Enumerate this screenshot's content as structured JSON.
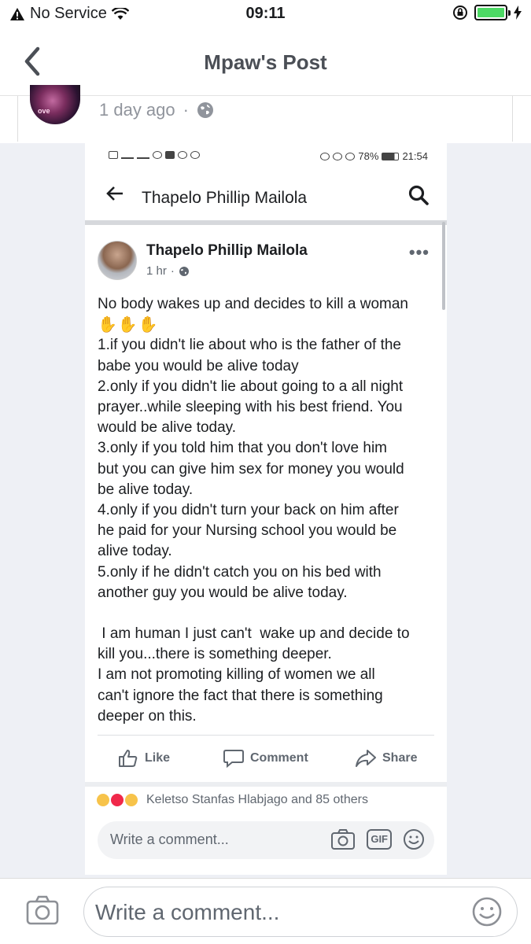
{
  "status_bar": {
    "carrier": "No Service",
    "time": "09:11",
    "icons": [
      "warning-icon",
      "wifi-icon",
      "orientation-lock-icon",
      "battery-icon",
      "charging-icon"
    ],
    "battery_color": "#4cd964"
  },
  "nav": {
    "title": "Mpaw's Post",
    "back_icon": "chevron-left-icon"
  },
  "outer_post": {
    "time": "1 day ago",
    "separator": "·",
    "privacy_icon": "globe-icon",
    "avatar_text": "ove"
  },
  "inner_screenshot": {
    "status_bar": {
      "battery": "78%",
      "time": "21:54"
    },
    "app_bar": {
      "title": "Thapelo Phillip Mailola"
    },
    "post": {
      "author": "Thapelo Phillip Mailola",
      "time": "1 hr",
      "separator": "·",
      "more": "•••",
      "lines": [
        "No body wakes up and decides to kill a woman",
        "✋✋✋",
        "1.if you didn't lie about who is the father of the",
        "babe you would be alive today",
        "2.only if you didn't lie about going to a all night",
        "prayer..while sleeping with his best friend. You",
        "would be alive today.",
        "3.only if you told him that you don't love him",
        "but you can give him sex for money you would",
        "be alive today.",
        "4.only if you didn't turn your back on him after",
        "he paid for your Nursing school you would be",
        "alive today.",
        "5.only if he didn't catch you on his bed with",
        "another guy you would be alive today.",
        "",
        " I am human I just can't  wake up and decide to",
        "kill you...there is something deeper.",
        "I am not promoting killing of women we all",
        "can't ignore the fact that there is something",
        "deeper on this."
      ],
      "actions": {
        "like": "Like",
        "comment": "Comment",
        "share": "Share"
      },
      "reactions_text": "Keletso Stanfas Hlabjago and 85 others",
      "comment_placeholder": "Write a comment...",
      "gif_label": "GIF"
    }
  },
  "bottom_bar": {
    "placeholder": "Write a comment..."
  }
}
